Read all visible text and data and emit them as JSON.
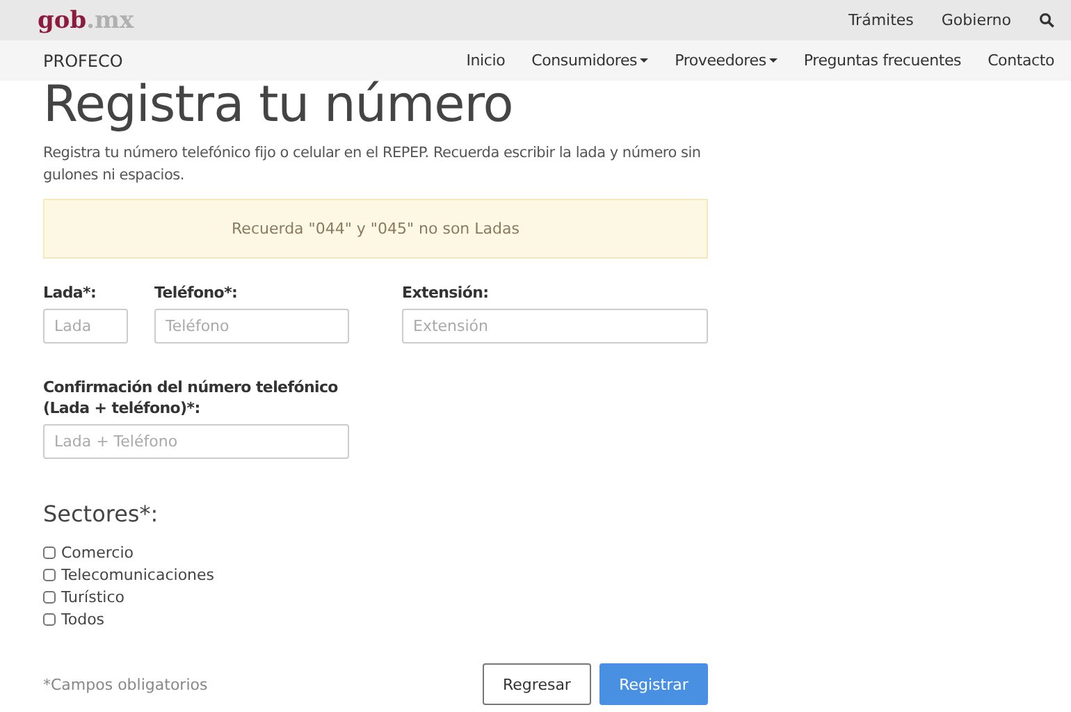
{
  "top_bar": {
    "logo": {
      "main": "gob",
      "suffix": ".mx"
    },
    "links": [
      "Trámites",
      "Gobierno"
    ]
  },
  "nav_bar": {
    "brand": "PROFECO",
    "items": [
      {
        "label": "Inicio",
        "dropdown": false
      },
      {
        "label": "Consumidores",
        "dropdown": true
      },
      {
        "label": "Proveedores",
        "dropdown": true
      },
      {
        "label": "Preguntas frecuentes",
        "dropdown": false
      },
      {
        "label": "Contacto",
        "dropdown": false
      }
    ]
  },
  "title": "Registra tu número",
  "intro": "Registra tu número telefónico fijo o celular en el REPEP. Recuerda escribir la lada y número sin gulones ni espacios.",
  "alert": "Recuerda \"044\" y \"045\" no son Ladas",
  "fields": [
    {
      "label": "Lada*:",
      "placeholder": "Lada"
    },
    {
      "label": "Teléfono*:",
      "placeholder": "Teléfono"
    },
    {
      "label": "Extensión:",
      "placeholder": "Extensión"
    }
  ],
  "confirm_field": {
    "label": "Confirmación del número telefónico (Lada + teléfono)*:",
    "placeholder": "Lada + Teléfono"
  },
  "sectors": {
    "heading": "Sectores*:",
    "options": [
      {
        "label": "Comercio",
        "checked": false
      },
      {
        "label": "Telecomunicaciones",
        "checked": false
      },
      {
        "label": "Turístico",
        "checked": false
      },
      {
        "label": "Todos",
        "checked": false
      }
    ]
  },
  "required_note": "*Campos obligatorios",
  "buttons": [
    {
      "label": "Regresar",
      "kind": "secondary"
    },
    {
      "label": "Registrar",
      "kind": "primary"
    }
  ]
}
